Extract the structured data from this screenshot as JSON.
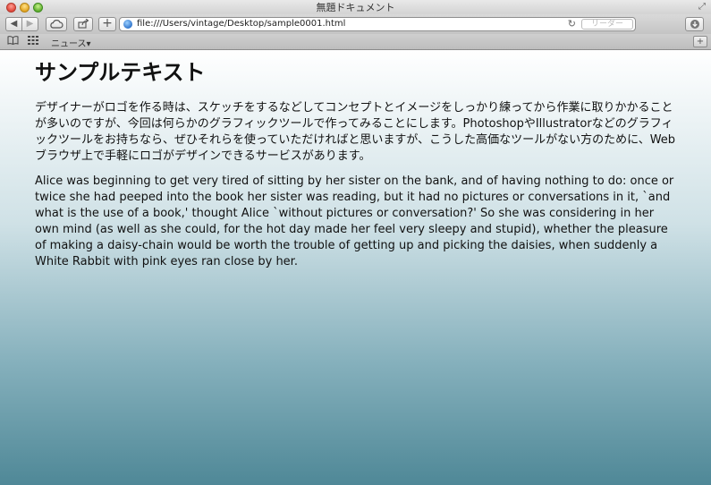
{
  "window": {
    "title": "無題ドキュメント"
  },
  "toolbar": {
    "url": "file:///Users/vintage/Desktop/sample0001.html",
    "reader_label": "リーダー",
    "back_glyph": "◀",
    "forward_glyph": "▶",
    "add_glyph": "+"
  },
  "bookmarks": {
    "news_label": "ニュース▾"
  },
  "page": {
    "heading": "サンプルテキスト",
    "paragraphs": [
      "デザイナーがロゴを作る時は、スケッチをするなどしてコンセプトとイメージをしっかり練ってから作業に取りかかることが多いのですが、今回は何らかのグラフィックツールで作ってみることにします。PhotoshopやIllustratorなどのグラフィックツールをお持ちなら、ぜひそれらを使っていただければと思いますが、こうした高価なツールがない方のために、Webブラウザ上で手軽にロゴがデザインできるサービスがあります。",
      "Alice was beginning to get very tired of sitting by her sister on the bank, and of having nothing to do: once or twice she had peeped into the book her sister was reading, but it had no pictures or conversations in it, `and what is the use of a book,' thought Alice `without pictures or conversation?' So she was considering in her own mind (as well as she could, for the hot day made her feel very sleepy and stupid), whether the pleasure of making a daisy-chain would be worth the trouble of getting up and picking the daisies, when suddenly a White Rabbit with pink eyes ran close by her."
    ]
  },
  "icons": {
    "close": "close-button-icon",
    "minimize": "minimize-button-icon",
    "zoom": "zoom-button-icon",
    "cloud": "icloud-tabs-icon",
    "share": "share-icon",
    "globe": "globe-icon",
    "reload": "reload-icon",
    "download": "download-icon",
    "book": "bookmarks-book-icon",
    "grid": "top-sites-grid-icon"
  }
}
